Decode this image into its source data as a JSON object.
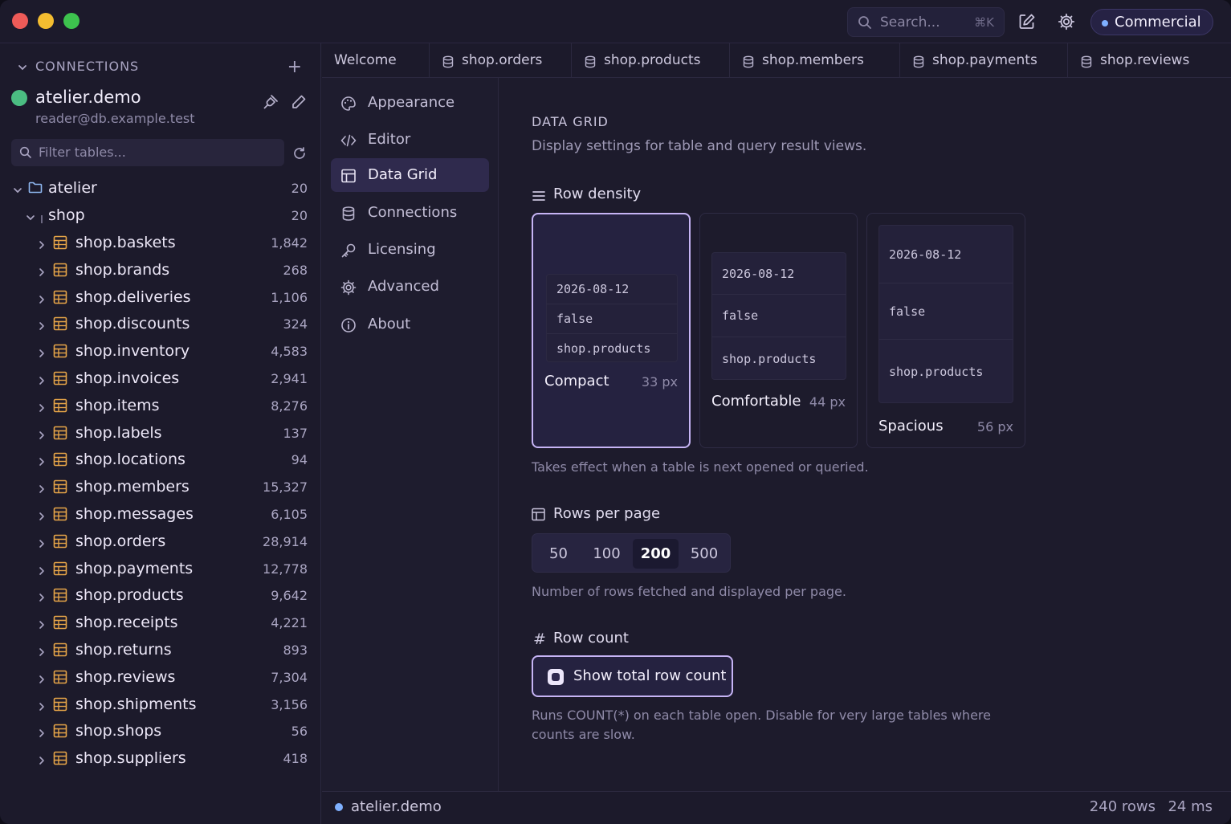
{
  "app": {
    "connection_label": "Commercial"
  },
  "search": {
    "placeholder": "Search...",
    "shortcut": "⌘K"
  },
  "sidebar": {
    "title": "CONNECTIONS",
    "add": "+",
    "connection": {
      "name": "atelier.demo",
      "user": "reader@db.example.test",
      "status_color": "#4bbd82"
    },
    "filter_placeholder": "Filter tables...",
    "database": {
      "name": "atelier",
      "count": "20"
    },
    "schema": {
      "name": "shop",
      "count": "20"
    },
    "tables": [
      {
        "name": "shop.baskets",
        "count": "1,842"
      },
      {
        "name": "shop.brands",
        "count": "268"
      },
      {
        "name": "shop.deliveries",
        "count": "1,106"
      },
      {
        "name": "shop.discounts",
        "count": "324"
      },
      {
        "name": "shop.inventory",
        "count": "4,583"
      },
      {
        "name": "shop.invoices",
        "count": "2,941"
      },
      {
        "name": "shop.items",
        "count": "8,276"
      },
      {
        "name": "shop.labels",
        "count": "137"
      },
      {
        "name": "shop.locations",
        "count": "94"
      },
      {
        "name": "shop.members",
        "count": "15,327"
      },
      {
        "name": "shop.messages",
        "count": "6,105"
      },
      {
        "name": "shop.orders",
        "count": "28,914"
      },
      {
        "name": "shop.payments",
        "count": "12,778"
      },
      {
        "name": "shop.products",
        "count": "9,642"
      },
      {
        "name": "shop.receipts",
        "count": "4,221"
      },
      {
        "name": "shop.returns",
        "count": "893"
      },
      {
        "name": "shop.reviews",
        "count": "7,304"
      },
      {
        "name": "shop.shipments",
        "count": "3,156"
      },
      {
        "name": "shop.shops",
        "count": "56"
      },
      {
        "name": "shop.suppliers",
        "count": "418"
      }
    ]
  },
  "tabs": [
    {
      "label": "Welcome",
      "icon": "none"
    },
    {
      "label": "shop.orders",
      "icon": "database-icon"
    },
    {
      "label": "shop.products",
      "icon": "database-icon"
    },
    {
      "label": "shop.members",
      "icon": "database-icon"
    },
    {
      "label": "shop.payments",
      "icon": "database-icon"
    },
    {
      "label": "shop.reviews",
      "icon": "database-icon"
    }
  ],
  "settings_nav": [
    {
      "label": "Appearance",
      "icon": "palette-icon"
    },
    {
      "label": "Editor",
      "icon": "code-icon"
    },
    {
      "label": "Data Grid",
      "icon": "table-icon",
      "active": true
    },
    {
      "label": "Connections",
      "icon": "database-icon"
    },
    {
      "label": "Licensing",
      "icon": "key-icon"
    },
    {
      "label": "Advanced",
      "icon": "gear-icon"
    },
    {
      "label": "About",
      "icon": "info-icon"
    }
  ],
  "content": {
    "title": "DATA GRID",
    "description": "Display settings for table and query result views.",
    "density": {
      "heading": "Row density",
      "hint": "Takes effect when a table is next opened or queried.",
      "preview_values": [
        "2026-08-12",
        "false",
        "shop.products"
      ],
      "options": [
        {
          "name": "Compact",
          "px": "33 px",
          "selected": true
        },
        {
          "name": "Comfortable",
          "px": "44 px",
          "selected": false
        },
        {
          "name": "Spacious",
          "px": "56 px",
          "selected": false
        }
      ]
    },
    "rows_per_page": {
      "heading": "Rows per page",
      "options": [
        "50",
        "100",
        "200",
        "500"
      ],
      "selected": "200",
      "hint": "Number of rows fetched and displayed per page."
    },
    "row_count": {
      "heading": "Row count",
      "toggle_label": "Show total row count",
      "checked": true,
      "hint_line1": "Runs COUNT(*) on each table open. Disable for very large tables where",
      "hint_line2": "counts are slow."
    }
  },
  "status": {
    "connection": "atelier.demo",
    "rows": "240 rows",
    "time": "24 ms"
  },
  "colors": {
    "accent": "#c6b4f5",
    "status_dot": "#7fb0ff",
    "background": "#1d1b2c"
  }
}
